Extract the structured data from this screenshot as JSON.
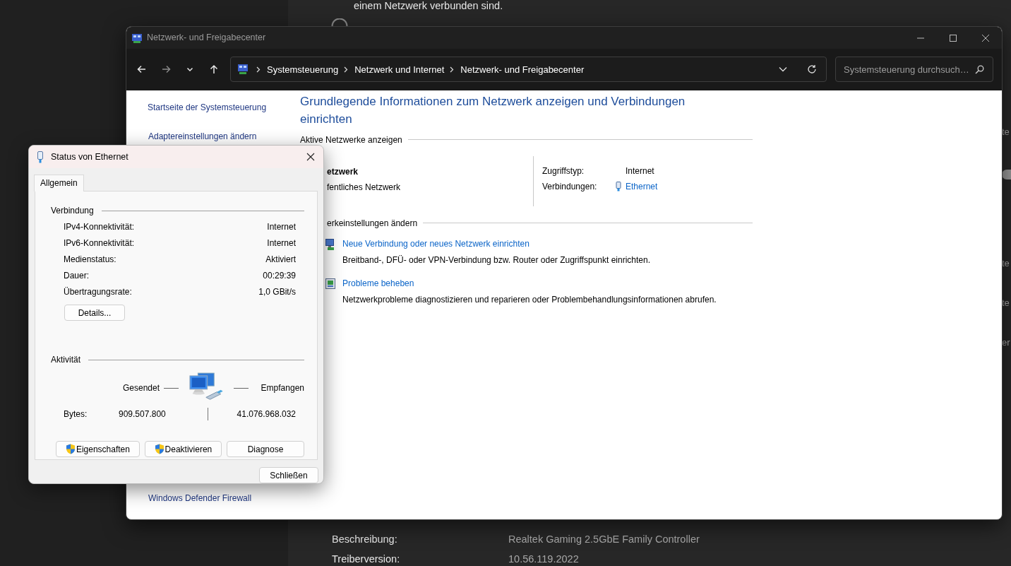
{
  "settings_background": {
    "note": "einem Netzwerk verbunden sind.",
    "radio": {
      "selected": false
    },
    "toggle": {
      "on": false
    },
    "properties": [
      {
        "label": "Beschreibung:",
        "value": "Realtek Gaming 2.5GbE Family Controller"
      },
      {
        "label": "Treiberversion:",
        "value": "10.56.119.2022"
      }
    ],
    "edge_fragments": [
      "te",
      "te",
      "te",
      "er"
    ]
  },
  "main_window": {
    "title": "Netzwerk- und Freigabecenter",
    "nav": [
      {
        "kind": "back",
        "disabled": false
      },
      {
        "kind": "forward",
        "disabled": true
      },
      {
        "kind": "recent",
        "disabled": false
      },
      {
        "kind": "up",
        "disabled": false
      }
    ],
    "breadcrumb": [
      "Systemsteuerung",
      "Netzwerk und Internet",
      "Netzwerk- und Freigabecenter"
    ],
    "search": {
      "placeholder": "Systemsteuerung durchsuch…"
    },
    "sidebar": {
      "top_links": [
        "Startseite der Systemsteuerung",
        "Adaptereinstellungen ändern"
      ],
      "bottom_links": [
        "Windows Defender Firewall"
      ]
    },
    "heading": "Grundlegende Informationen zum Netzwerk anzeigen und Verbindungen einrichten",
    "active_networks": {
      "title": "Aktive Netzwerke anzeigen",
      "network_name": "etzwerk",
      "network_type": "fentliches Netzwerk",
      "access_type_label": "Zugriffstyp:",
      "access_type": "Internet",
      "connections_label": "Verbindungen:",
      "connection": "Ethernet"
    },
    "change_settings": {
      "title": "erkeinstellungen ändern",
      "tasks": [
        {
          "link": "Neue Verbindung oder neues Netzwerk einrichten",
          "description": "Breitband-, DFÜ- oder VPN-Verbindung bzw. Router oder Zugriffspunkt einrichten."
        },
        {
          "link": "Probleme beheben",
          "description": "Netzwerkprobleme diagnostizieren und reparieren oder Problembehandlungsinformationen abrufen."
        }
      ]
    }
  },
  "dialog": {
    "title": "Status von Ethernet",
    "tabs": [
      {
        "label": "Allgemein",
        "selected": true
      }
    ],
    "connection": {
      "title": "Verbindung",
      "rows": [
        {
          "label": "IPv4-Konnektivität:",
          "value": "Internet"
        },
        {
          "label": "IPv6-Konnektivität:",
          "value": "Internet"
        },
        {
          "label": "Medienstatus:",
          "value": "Aktiviert"
        },
        {
          "label": "Dauer:",
          "value": "00:29:39"
        },
        {
          "label": "Übertragungsrate:",
          "value": "1,0 GBit/s"
        }
      ],
      "details_button": "Details..."
    },
    "activity": {
      "title": "Aktivität",
      "sent_label": "Gesendet",
      "received_label": "Empfangen",
      "bytes_label": "Bytes:",
      "sent": "909.507.800",
      "received": "41.076.968.032"
    },
    "buttons": [
      {
        "label": "Eigenschaften",
        "shield": true
      },
      {
        "label": "Deaktivieren",
        "shield": true
      },
      {
        "label": "Diagnose",
        "shield": false
      }
    ],
    "close_button": "Schließen"
  }
}
